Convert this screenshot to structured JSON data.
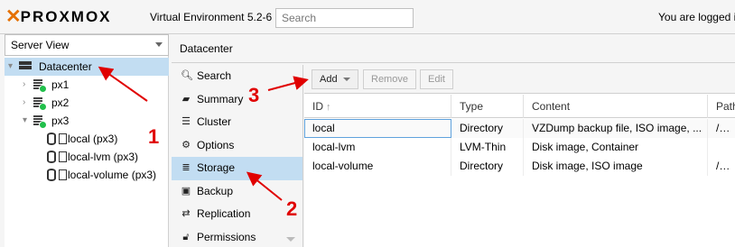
{
  "header": {
    "logo_text": "PROXMOX",
    "version": "Virtual Environment 5.2-6",
    "search_placeholder": "Search",
    "user_text": "You are logged in"
  },
  "tree": {
    "view": "Server View",
    "items": [
      {
        "label": "Datacenter",
        "icon": "datacenter-icon"
      },
      {
        "label": "px1",
        "icon": "node-online-icon"
      },
      {
        "label": "px2",
        "icon": "node-online-icon"
      },
      {
        "label": "px3",
        "icon": "node-online-icon"
      },
      {
        "label": "local (px3)",
        "icon": "storage-icon"
      },
      {
        "label": "local-lvm (px3)",
        "icon": "storage-icon"
      },
      {
        "label": "local-volume (px3)",
        "icon": "storage-icon"
      }
    ]
  },
  "panel": {
    "title": "Datacenter"
  },
  "menu": {
    "items": [
      {
        "label": "Search",
        "icon": "search-icon"
      },
      {
        "label": "Summary",
        "icon": "book-icon"
      },
      {
        "label": "Cluster",
        "icon": "server-icon"
      },
      {
        "label": "Options",
        "icon": "gear-icon"
      },
      {
        "label": "Storage",
        "icon": "database-icon"
      },
      {
        "label": "Backup",
        "icon": "floppy-icon"
      },
      {
        "label": "Replication",
        "icon": "retweet-icon"
      },
      {
        "label": "Permissions",
        "icon": "unlock-icon"
      }
    ],
    "selected": "Storage"
  },
  "toolbar": {
    "add_label": "Add",
    "remove_label": "Remove",
    "edit_label": "Edit"
  },
  "grid": {
    "columns": [
      "ID",
      "Type",
      "Content",
      "Path"
    ],
    "sort_indicator": "↑",
    "rows": [
      {
        "id": "local",
        "type": "Directory",
        "content": "VZDump backup file, ISO image, ...",
        "path": "/var/"
      },
      {
        "id": "local-lvm",
        "type": "LVM-Thin",
        "content": "Disk image, Container",
        "path": ""
      },
      {
        "id": "local-volume",
        "type": "Directory",
        "content": "Disk image, ISO image",
        "path": "/mnt"
      }
    ]
  },
  "annotations": {
    "step1": "1",
    "step2": "2",
    "step3": "3",
    "color": "#e00000"
  },
  "colors": {
    "brand_orange": "#e57000",
    "selection": "#c2ddf2",
    "status_ok": "#21bf4b"
  }
}
